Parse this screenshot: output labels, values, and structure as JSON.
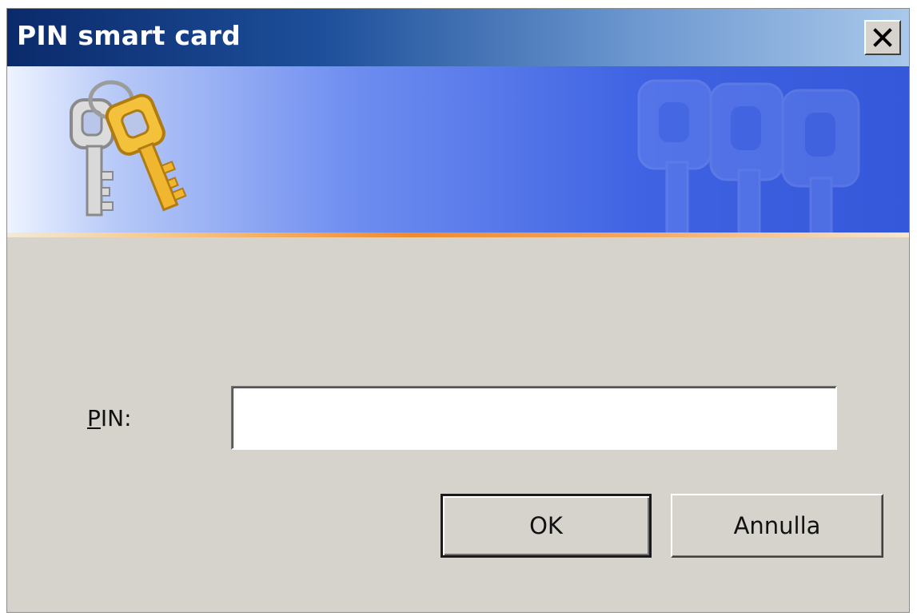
{
  "window": {
    "title": "PIN smart card",
    "close_icon": "close-icon"
  },
  "banner": {
    "icon": "keys-icon",
    "watermark_icon": "keys-watermark-icon",
    "colors": {
      "stripe": "#ef8a2e",
      "banner_blue": "#3f63e3"
    }
  },
  "form": {
    "pin_label_accel": "P",
    "pin_label_rest": "IN:",
    "pin_value": "",
    "pin_placeholder": ""
  },
  "buttons": {
    "ok_label": "OK",
    "cancel_label": "Annulla"
  }
}
